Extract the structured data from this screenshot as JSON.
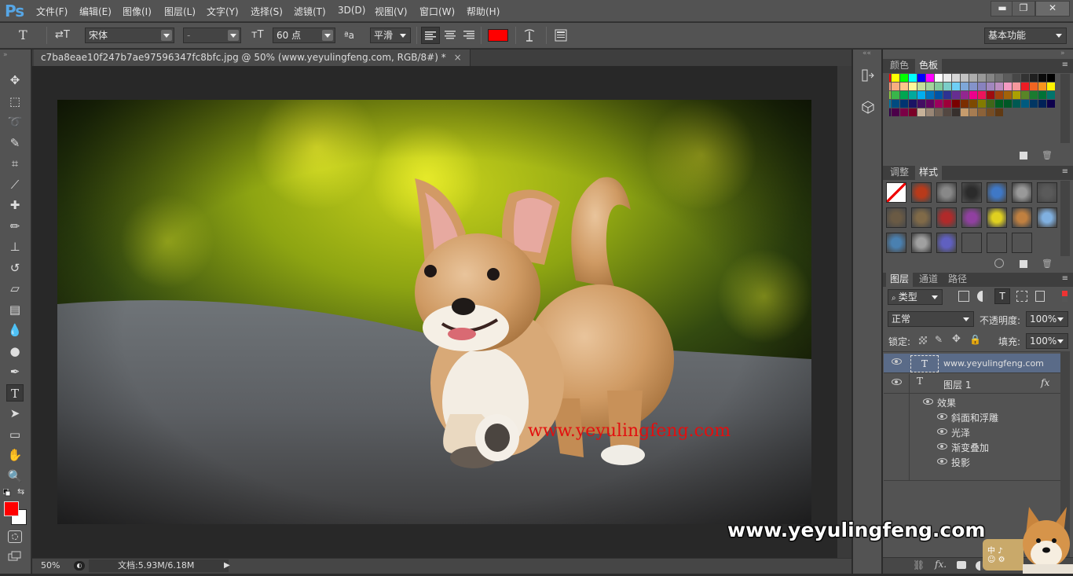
{
  "app": {
    "logo": "Ps"
  },
  "menu": [
    "文件(F)",
    "编辑(E)",
    "图像(I)",
    "图层(L)",
    "文字(Y)",
    "选择(S)",
    "滤镜(T)",
    "3D(D)",
    "视图(V)",
    "窗口(W)",
    "帮助(H)"
  ],
  "window_buttons": {
    "minimize": "▬",
    "restore": "❐",
    "close": "✕"
  },
  "options": {
    "tool_glyph": "T",
    "orient_glyph": "⇄T",
    "font_family": "宋体",
    "font_style": "-",
    "size_glyph": "ᴛT",
    "font_size": "60 点",
    "aa_glyph": "ªa",
    "antialias": "平滑",
    "text_color": "#ff0000",
    "workspace": "基本功能"
  },
  "document": {
    "tab_title": "c7ba8eae10f247b7ae97596347fc8bfc.jpg @ 50% (www.yeyulingfeng.com, RGB/8#) *",
    "tab_close": "×",
    "watermark_text": "www.yeyulingfeng.com",
    "watermark_color": "#e20f0f"
  },
  "status": {
    "zoom": "50%",
    "doc_info": "文档:5.93M/6.18M"
  },
  "panels": {
    "swatch_tabs": [
      "颜色",
      "色板"
    ],
    "style_tabs": [
      "调整",
      "样式"
    ],
    "layer_tabs": [
      "图层",
      "通道",
      "路径"
    ],
    "filter_kind": "类型",
    "blend_mode": "正常",
    "opacity_label": "不透明度:",
    "opacity_value": "100%",
    "lock_label": "锁定:",
    "fill_label": "填充:",
    "fill_value": "100%",
    "layers": [
      {
        "name": "www.yeyulingfeng.com",
        "type": "T"
      },
      {
        "name": "图层 1",
        "type": "T",
        "fx": "fx"
      }
    ],
    "effects_label": "效果",
    "effects": [
      "斜面和浮雕",
      "光泽",
      "渐变叠加",
      "投影"
    ]
  },
  "overlay_watermark": "www.yeyulingfeng.com",
  "tools": [
    "move-tool",
    "marquee-tool",
    "lasso-tool",
    "quick-select-tool",
    "crop-tool",
    "eyedropper-tool",
    "healing-brush-tool",
    "brush-tool",
    "clone-stamp-tool",
    "history-brush-tool",
    "eraser-tool",
    "gradient-tool",
    "blur-tool",
    "dodge-tool",
    "pen-tool",
    "type-tool",
    "path-select-tool",
    "rectangle-tool",
    "hand-tool",
    "zoom-tool"
  ],
  "colors": {
    "foreground": "#ff0000",
    "background": "#ffffff"
  }
}
